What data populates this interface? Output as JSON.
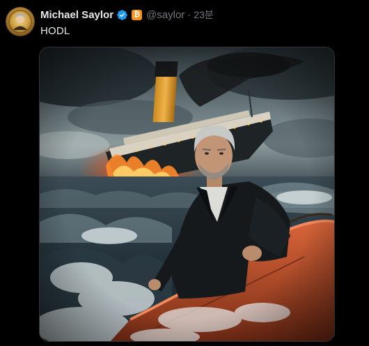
{
  "author": {
    "display_name": "Michael Saylor",
    "verified_icon": "verified-badge-icon",
    "affiliate_badge_icon": "bitcoin-badge-icon",
    "affiliate_badge_glyph": "₿",
    "handle": "@saylor",
    "separator": "·",
    "time": "23분"
  },
  "post": {
    "text": "HODL",
    "media_icon": "photo-man-in-lifeboat-sinking-ship"
  },
  "colors": {
    "background": "#000000",
    "text_primary": "#e7e9ea",
    "text_secondary": "#71767b",
    "verified_blue": "#1d9bf0",
    "bitcoin_orange": "#f7931a"
  }
}
